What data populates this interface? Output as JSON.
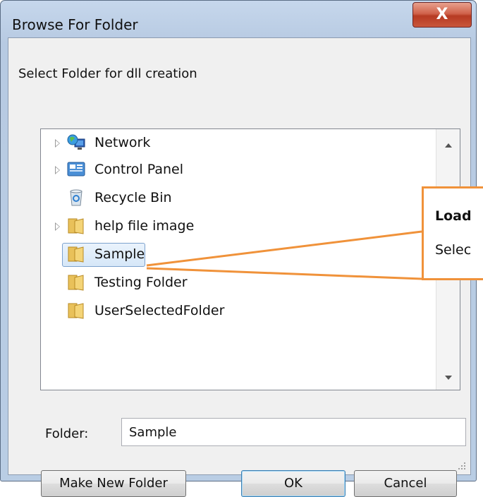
{
  "window": {
    "title": "Browse For Folder",
    "close_label": "X",
    "instruction": "Select Folder for dll creation"
  },
  "tree": {
    "items": [
      {
        "label": "Network",
        "icon": "network-icon",
        "expandable": true
      },
      {
        "label": "Control Panel",
        "icon": "control-panel-icon",
        "expandable": true
      },
      {
        "label": "Recycle Bin",
        "icon": "recycle-bin-icon",
        "expandable": false
      },
      {
        "label": "help file image",
        "icon": "folder-icon",
        "expandable": true
      },
      {
        "label": "Sample",
        "icon": "folder-icon",
        "expandable": false,
        "selected": true
      },
      {
        "label": "Testing Folder",
        "icon": "folder-icon",
        "expandable": false
      },
      {
        "label": "UserSelectedFolder",
        "icon": "folder-icon",
        "expandable": false
      }
    ]
  },
  "folder_field": {
    "label": "Folder:",
    "value": "Sample"
  },
  "buttons": {
    "make_new_folder": "Make New Folder",
    "ok": "OK",
    "cancel": "Cancel"
  },
  "callout": {
    "title": "Load",
    "text": "Selec"
  },
  "colors": {
    "accent_orange": "#f0923a",
    "selection_border": "#7da2ce",
    "close_red": "#c9563c"
  }
}
